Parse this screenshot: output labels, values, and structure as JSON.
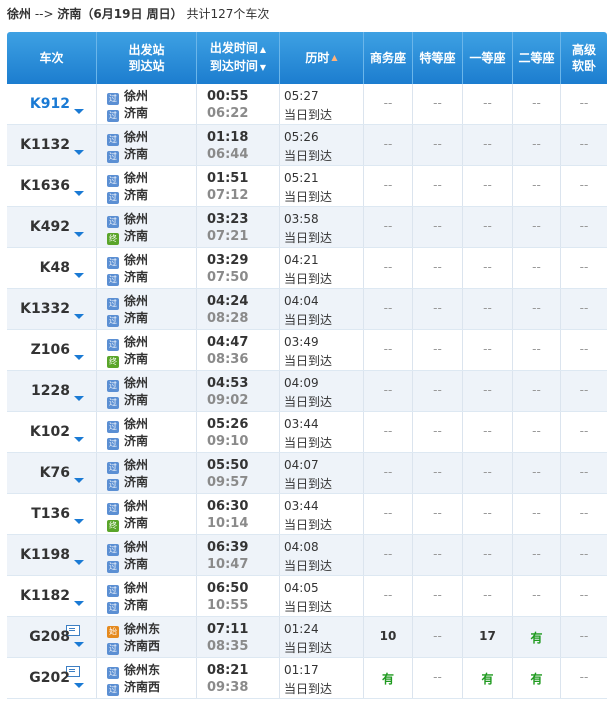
{
  "summary": {
    "from": "徐州",
    "arrow": "-->",
    "to": "济南",
    "date": "（6月19日  周日）",
    "count_text": "共计127个车次"
  },
  "headers": {
    "train": "车次",
    "station_line1": "出发站",
    "station_line2": "到达站",
    "time_line1": "出发时间",
    "time_line2": "到达时间",
    "duration": "历时",
    "business": "商务座",
    "special": "特等座",
    "first": "一等座",
    "second": "二等座",
    "soft_line1": "高级",
    "soft_line2": "软卧"
  },
  "badges": {
    "pass": "过",
    "end": "终",
    "start": "始"
  },
  "colors": {
    "header_blue": "#1c7dcf",
    "link_blue": "#1a7ad4",
    "available_green": "#1f9a1f"
  },
  "trains": [
    {
      "no": "K912",
      "link": true,
      "ticket_icon": false,
      "from": "徐州",
      "from_badge": "pass",
      "to": "济南",
      "to_badge": "pass",
      "dep": "00:55",
      "arr": "06:22",
      "dur": "05:27",
      "day": "当日到达",
      "business": "--",
      "special": "--",
      "first": "--",
      "second": "--",
      "soft": "--"
    },
    {
      "no": "K1132",
      "link": false,
      "ticket_icon": false,
      "from": "徐州",
      "from_badge": "pass",
      "to": "济南",
      "to_badge": "pass",
      "dep": "01:18",
      "arr": "06:44",
      "dur": "05:26",
      "day": "当日到达",
      "business": "--",
      "special": "--",
      "first": "--",
      "second": "--",
      "soft": "--"
    },
    {
      "no": "K1636",
      "link": false,
      "ticket_icon": false,
      "from": "徐州",
      "from_badge": "pass",
      "to": "济南",
      "to_badge": "pass",
      "dep": "01:51",
      "arr": "07:12",
      "dur": "05:21",
      "day": "当日到达",
      "business": "--",
      "special": "--",
      "first": "--",
      "second": "--",
      "soft": "--"
    },
    {
      "no": "K492",
      "link": false,
      "ticket_icon": false,
      "from": "徐州",
      "from_badge": "pass",
      "to": "济南",
      "to_badge": "end",
      "dep": "03:23",
      "arr": "07:21",
      "dur": "03:58",
      "day": "当日到达",
      "business": "--",
      "special": "--",
      "first": "--",
      "second": "--",
      "soft": "--"
    },
    {
      "no": "K48",
      "link": false,
      "ticket_icon": false,
      "from": "徐州",
      "from_badge": "pass",
      "to": "济南",
      "to_badge": "pass",
      "dep": "03:29",
      "arr": "07:50",
      "dur": "04:21",
      "day": "当日到达",
      "business": "--",
      "special": "--",
      "first": "--",
      "second": "--",
      "soft": "--"
    },
    {
      "no": "K1332",
      "link": false,
      "ticket_icon": false,
      "from": "徐州",
      "from_badge": "pass",
      "to": "济南",
      "to_badge": "pass",
      "dep": "04:24",
      "arr": "08:28",
      "dur": "04:04",
      "day": "当日到达",
      "business": "--",
      "special": "--",
      "first": "--",
      "second": "--",
      "soft": "--"
    },
    {
      "no": "Z106",
      "link": false,
      "ticket_icon": false,
      "from": "徐州",
      "from_badge": "pass",
      "to": "济南",
      "to_badge": "end",
      "dep": "04:47",
      "arr": "08:36",
      "dur": "03:49",
      "day": "当日到达",
      "business": "--",
      "special": "--",
      "first": "--",
      "second": "--",
      "soft": "--"
    },
    {
      "no": "1228",
      "link": false,
      "ticket_icon": false,
      "from": "徐州",
      "from_badge": "pass",
      "to": "济南",
      "to_badge": "pass",
      "dep": "04:53",
      "arr": "09:02",
      "dur": "04:09",
      "day": "当日到达",
      "business": "--",
      "special": "--",
      "first": "--",
      "second": "--",
      "soft": "--"
    },
    {
      "no": "K102",
      "link": false,
      "ticket_icon": false,
      "from": "徐州",
      "from_badge": "pass",
      "to": "济南",
      "to_badge": "pass",
      "dep": "05:26",
      "arr": "09:10",
      "dur": "03:44",
      "day": "当日到达",
      "business": "--",
      "special": "--",
      "first": "--",
      "second": "--",
      "soft": "--"
    },
    {
      "no": "K76",
      "link": false,
      "ticket_icon": false,
      "from": "徐州",
      "from_badge": "pass",
      "to": "济南",
      "to_badge": "pass",
      "dep": "05:50",
      "arr": "09:57",
      "dur": "04:07",
      "day": "当日到达",
      "business": "--",
      "special": "--",
      "first": "--",
      "second": "--",
      "soft": "--"
    },
    {
      "no": "T136",
      "link": false,
      "ticket_icon": false,
      "from": "徐州",
      "from_badge": "pass",
      "to": "济南",
      "to_badge": "end",
      "dep": "06:30",
      "arr": "10:14",
      "dur": "03:44",
      "day": "当日到达",
      "business": "--",
      "special": "--",
      "first": "--",
      "second": "--",
      "soft": "--"
    },
    {
      "no": "K1198",
      "link": false,
      "ticket_icon": false,
      "from": "徐州",
      "from_badge": "pass",
      "to": "济南",
      "to_badge": "pass",
      "dep": "06:39",
      "arr": "10:47",
      "dur": "04:08",
      "day": "当日到达",
      "business": "--",
      "special": "--",
      "first": "--",
      "second": "--",
      "soft": "--"
    },
    {
      "no": "K1182",
      "link": false,
      "ticket_icon": false,
      "from": "徐州",
      "from_badge": "pass",
      "to": "济南",
      "to_badge": "pass",
      "dep": "06:50",
      "arr": "10:55",
      "dur": "04:05",
      "day": "当日到达",
      "business": "--",
      "special": "--",
      "first": "--",
      "second": "--",
      "soft": "--"
    },
    {
      "no": "G208",
      "link": false,
      "ticket_icon": true,
      "from": "徐州东",
      "from_badge": "start",
      "to": "济南西",
      "to_badge": "pass",
      "dep": "07:11",
      "arr": "08:35",
      "dur": "01:24",
      "day": "当日到达",
      "business": "10",
      "special": "--",
      "first": "17",
      "second": "有",
      "soft": "--"
    },
    {
      "no": "G202",
      "link": false,
      "ticket_icon": true,
      "from": "徐州东",
      "from_badge": "pass",
      "to": "济南西",
      "to_badge": "pass",
      "dep": "08:21",
      "arr": "09:38",
      "dur": "01:17",
      "day": "当日到达",
      "business": "有",
      "special": "--",
      "first": "有",
      "second": "有",
      "soft": "--"
    }
  ]
}
